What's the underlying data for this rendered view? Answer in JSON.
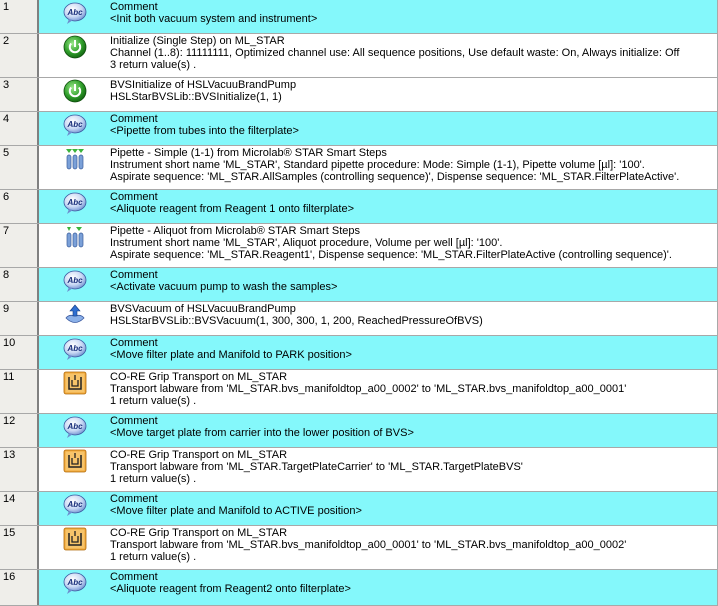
{
  "steps": [
    {
      "num": "1",
      "kind": "comment",
      "icon": "abc-comment-icon",
      "lines": [
        "Comment",
        "<Init both vacuum system and instrument>"
      ]
    },
    {
      "num": "2",
      "kind": "step",
      "icon": "power-icon",
      "lines": [
        "Initialize (Single Step) on ML_STAR",
        "Channel (1..8): 11111111, Optimized channel use: All sequence positions, Use default waste: On, Always initialize: Off",
        "3 return value(s) ."
      ]
    },
    {
      "num": "3",
      "kind": "step",
      "icon": "power-icon",
      "lines": [
        "BVSInitialize of HSLVacuuBrandPump",
        "HSLStarBVSLib::BVSInitialize(1, 1)"
      ]
    },
    {
      "num": "4",
      "kind": "comment",
      "icon": "abc-comment-icon",
      "lines": [
        "Comment",
        "<Pipette from tubes into the filterplate>"
      ]
    },
    {
      "num": "5",
      "kind": "step",
      "icon": "pipette-simple-icon",
      "lines": [
        "Pipette - Simple (1-1) from Microlab® STAR Smart Steps",
        "Instrument short name 'ML_STAR', Standard pipette procedure: Mode: Simple (1-1), Pipette volume [µl]: '100'.",
        "Aspirate sequence: 'ML_STAR.AllSamples (controlling sequence)', Dispense sequence: 'ML_STAR.FilterPlateActive'."
      ]
    },
    {
      "num": "6",
      "kind": "comment",
      "icon": "abc-comment-icon",
      "lines": [
        "Comment",
        "<Aliquote reagent from Reagent 1 onto filterplate>"
      ]
    },
    {
      "num": "7",
      "kind": "step",
      "icon": "pipette-aliquot-icon",
      "lines": [
        "Pipette - Aliquot from Microlab® STAR Smart Steps",
        "Instrument short name 'ML_STAR', Aliquot procedure, Volume per well [µl]: '100'.",
        "Aspirate sequence: 'ML_STAR.Reagent1', Dispense sequence: 'ML_STAR.FilterPlateActive (controlling sequence)'."
      ]
    },
    {
      "num": "8",
      "kind": "comment",
      "icon": "abc-comment-icon",
      "lines": [
        "Comment",
        "<Activate vacuum pump to wash the samples>"
      ]
    },
    {
      "num": "9",
      "kind": "step",
      "icon": "vacuum-icon",
      "lines": [
        "BVSVacuum of HSLVacuuBrandPump",
        "HSLStarBVSLib::BVSVacuum(1, 300, 300, 1, 200, ReachedPressureOfBVS)"
      ]
    },
    {
      "num": "10",
      "kind": "comment",
      "icon": "abc-comment-icon",
      "lines": [
        "Comment",
        "<Move filter plate and Manifold to PARK position>"
      ]
    },
    {
      "num": "11",
      "kind": "step",
      "icon": "grip-transport-icon",
      "lines": [
        "CO-RE Grip Transport on ML_STAR",
        "Transport labware from 'ML_STAR.bvs_manifoldtop_a00_0002' to 'ML_STAR.bvs_manifoldtop_a00_0001'",
        "1 return value(s) ."
      ]
    },
    {
      "num": "12",
      "kind": "comment",
      "icon": "abc-comment-icon",
      "lines": [
        "Comment",
        "<Move target plate from carrier into the lower position of BVS>"
      ]
    },
    {
      "num": "13",
      "kind": "step",
      "icon": "grip-transport-icon",
      "lines": [
        "CO-RE Grip Transport on ML_STAR",
        "Transport labware from 'ML_STAR.TargetPlateCarrier' to 'ML_STAR.TargetPlateBVS'",
        "1 return value(s) ."
      ]
    },
    {
      "num": "14",
      "kind": "comment",
      "icon": "abc-comment-icon",
      "lines": [
        "Comment",
        "<Move filter plate and Manifold to ACTIVE position>"
      ]
    },
    {
      "num": "15",
      "kind": "step",
      "icon": "grip-transport-icon",
      "lines": [
        "CO-RE Grip Transport on ML_STAR",
        "Transport labware from 'ML_STAR.bvs_manifoldtop_a00_0001' to 'ML_STAR.bvs_manifoldtop_a00_0002'",
        "1 return value(s) ."
      ]
    },
    {
      "num": "16",
      "kind": "comment",
      "icon": "abc-comment-icon",
      "lines": [
        "Comment",
        "<Aliquote reagent from Reagent2 onto filterplate>"
      ]
    }
  ],
  "colors": {
    "comment_bg": "#84f8fb",
    "step_bg": "#ffffff",
    "number_bg": "#efeeea"
  }
}
